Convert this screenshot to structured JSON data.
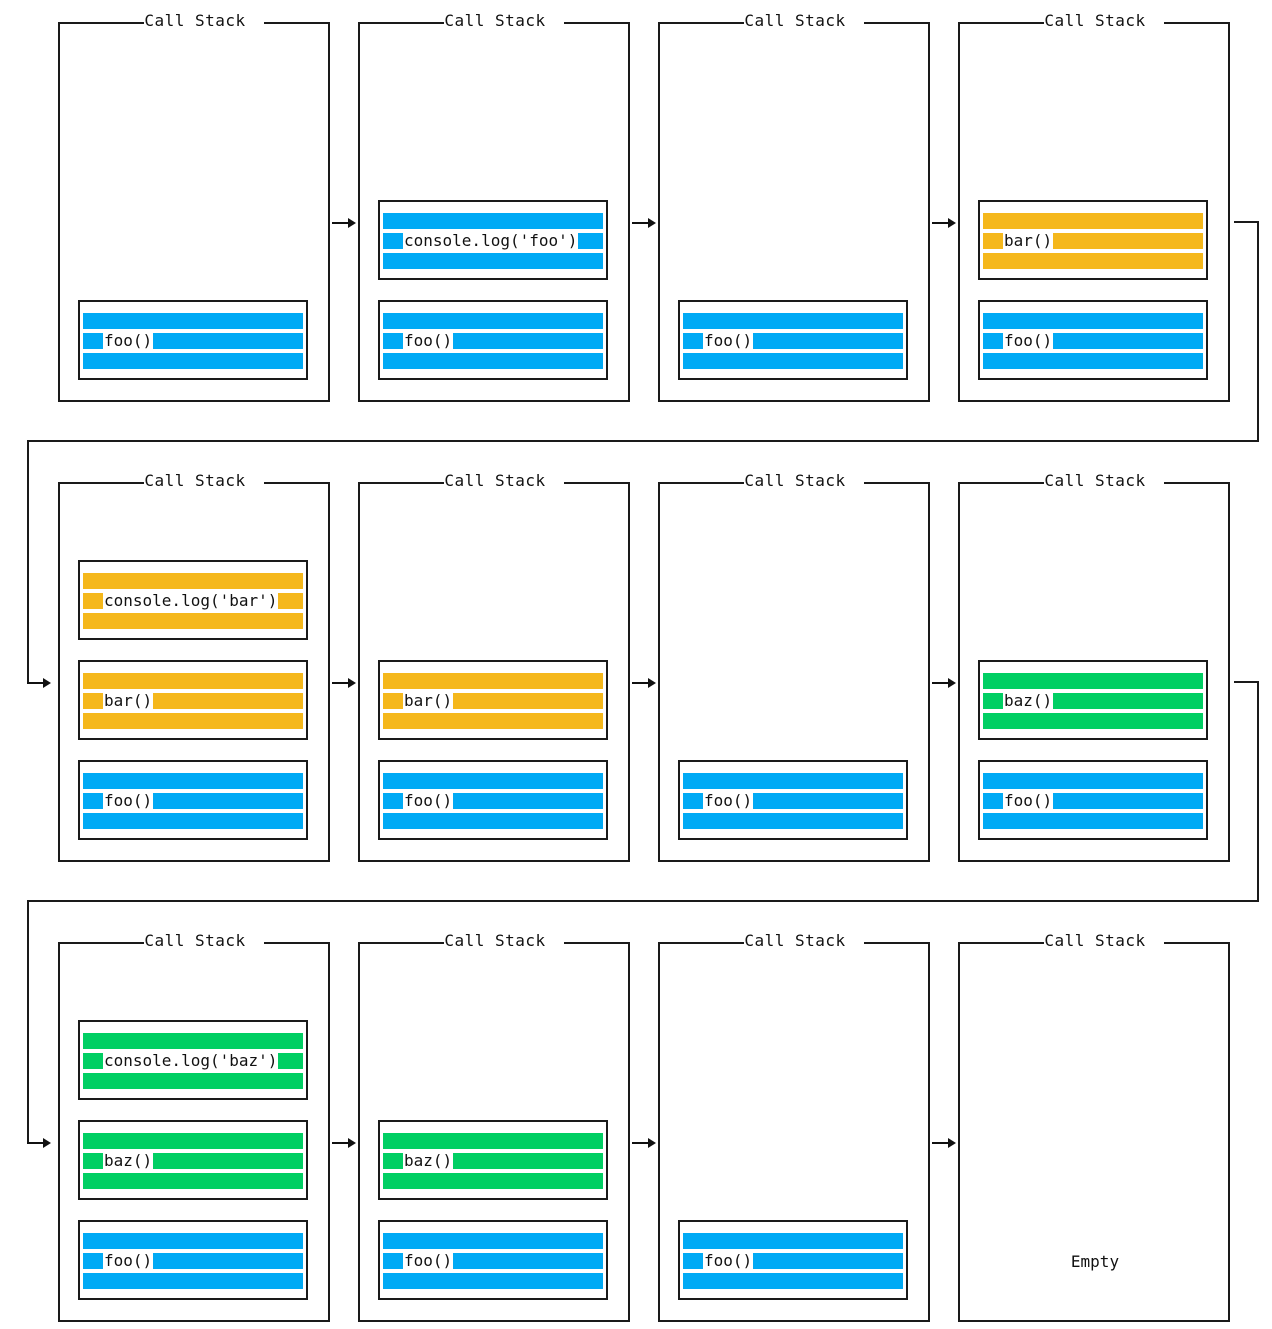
{
  "panel_title": "Call Stack",
  "empty_label": "Empty",
  "colors": {
    "foo": "#00aaf5",
    "bar": "#f5b81c",
    "baz": "#00cf63",
    "border": "#1a1a1a"
  },
  "rows": [
    {
      "steps": [
        {
          "frames": [
            {
              "label": "foo()",
              "fn": "foo"
            }
          ]
        },
        {
          "frames": [
            {
              "label": "foo()",
              "fn": "foo"
            },
            {
              "label": "console.log('foo')",
              "fn": "foo"
            }
          ]
        },
        {
          "frames": [
            {
              "label": "foo()",
              "fn": "foo"
            }
          ]
        },
        {
          "frames": [
            {
              "label": "foo()",
              "fn": "foo"
            },
            {
              "label": "bar()",
              "fn": "bar"
            }
          ]
        }
      ]
    },
    {
      "steps": [
        {
          "frames": [
            {
              "label": "foo()",
              "fn": "foo"
            },
            {
              "label": "bar()",
              "fn": "bar"
            },
            {
              "label": "console.log('bar')",
              "fn": "bar"
            }
          ]
        },
        {
          "frames": [
            {
              "label": "foo()",
              "fn": "foo"
            },
            {
              "label": "bar()",
              "fn": "bar"
            }
          ]
        },
        {
          "frames": [
            {
              "label": "foo()",
              "fn": "foo"
            }
          ]
        },
        {
          "frames": [
            {
              "label": "foo()",
              "fn": "foo"
            },
            {
              "label": "baz()",
              "fn": "baz"
            }
          ]
        }
      ]
    },
    {
      "steps": [
        {
          "frames": [
            {
              "label": "foo()",
              "fn": "foo"
            },
            {
              "label": "baz()",
              "fn": "baz"
            },
            {
              "label": "console.log('baz')",
              "fn": "baz"
            }
          ]
        },
        {
          "frames": [
            {
              "label": "foo()",
              "fn": "foo"
            },
            {
              "label": "baz()",
              "fn": "baz"
            }
          ]
        },
        {
          "frames": [
            {
              "label": "foo()",
              "fn": "foo"
            }
          ]
        },
        {
          "frames": [],
          "empty": true
        }
      ]
    }
  ]
}
